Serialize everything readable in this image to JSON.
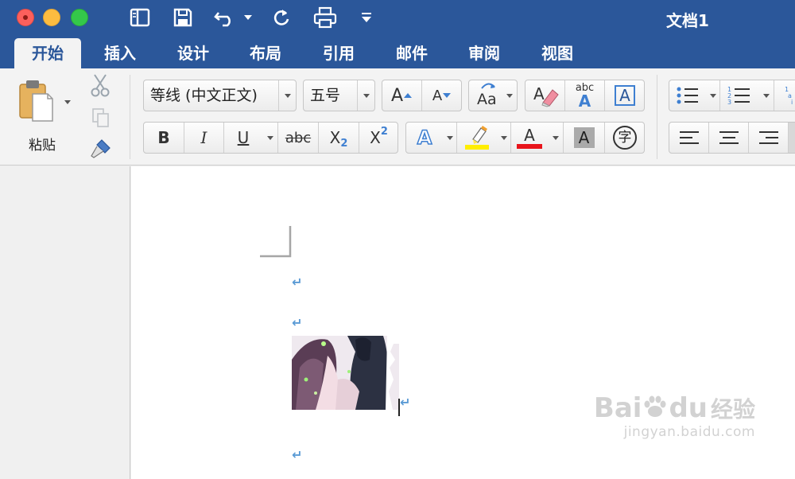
{
  "window": {
    "title": "文档1"
  },
  "ribbon_tabs": [
    {
      "label": "开始",
      "active": true
    },
    {
      "label": "插入",
      "active": false
    },
    {
      "label": "设计",
      "active": false
    },
    {
      "label": "布局",
      "active": false
    },
    {
      "label": "引用",
      "active": false
    },
    {
      "label": "邮件",
      "active": false
    },
    {
      "label": "审阅",
      "active": false
    },
    {
      "label": "视图",
      "active": false
    }
  ],
  "clipboard": {
    "paste_label": "粘贴"
  },
  "font": {
    "name": "等线 (中文正文)",
    "size": "五号",
    "grow_label": "A",
    "shrink_label": "A",
    "case_label": "Aa",
    "phonetic_label": "abc",
    "border_label": "A"
  },
  "format": {
    "bold": "B",
    "italic": "I",
    "underline": "U",
    "strike": "abc",
    "sub_base": "X",
    "sub_sup": "2",
    "sup_base": "X",
    "sup_sup": "2",
    "effects": "A",
    "font_color": "A",
    "shading": "A",
    "enclose": "字"
  },
  "colors": {
    "accent": "#2b579a",
    "highlight": "#ffee00",
    "font_color": "#e8141b",
    "paragraph_mark": "#5b9bd5"
  },
  "watermark": {
    "brand": "Bai",
    "brand2": "du",
    "cn": "经验",
    "url": "jingyan.baidu.com"
  }
}
